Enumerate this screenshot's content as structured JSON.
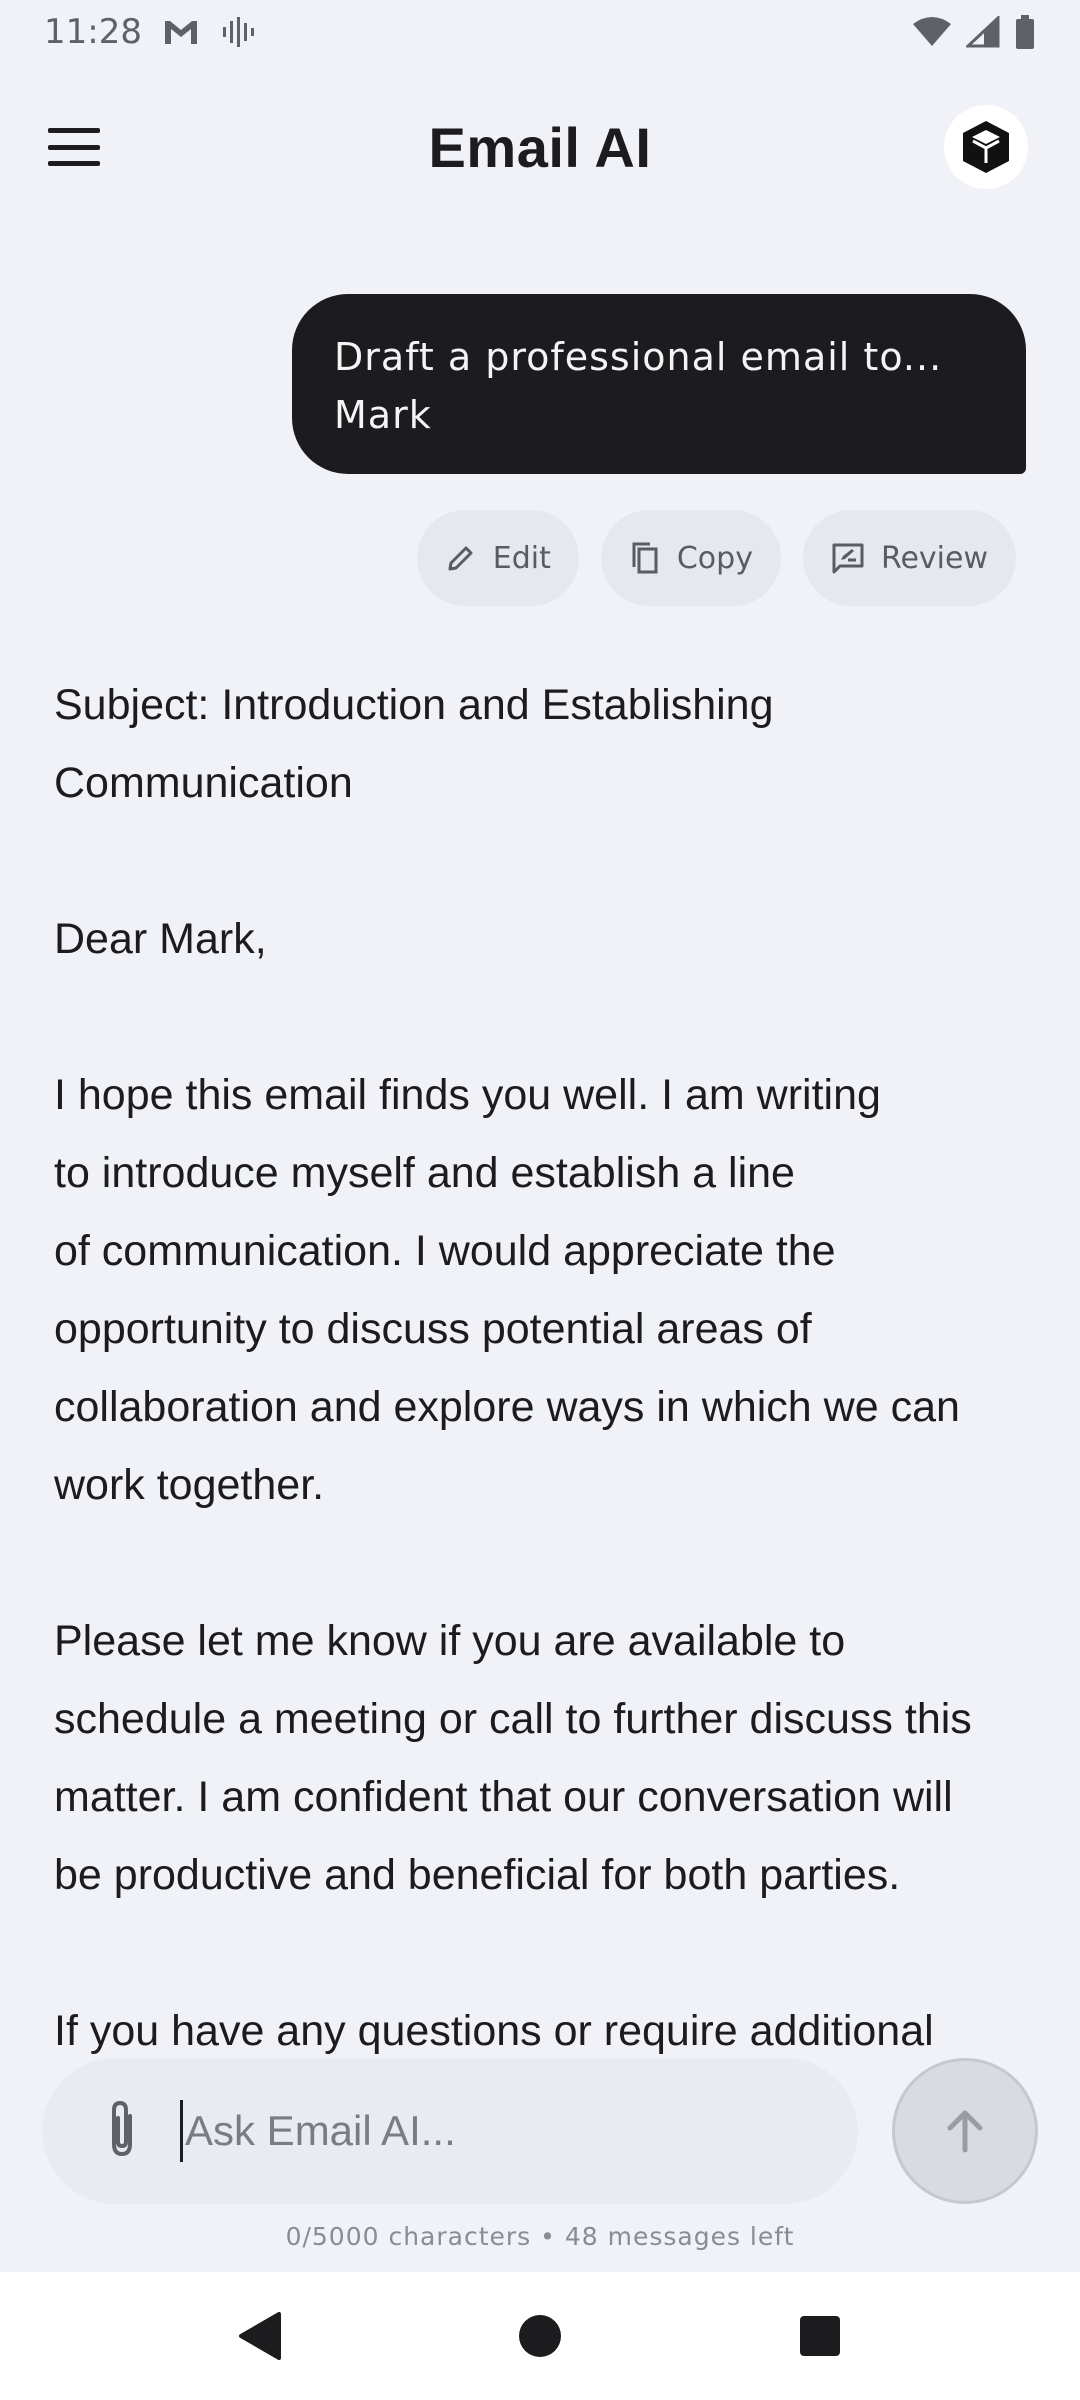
{
  "status_bar": {
    "time": "11:28",
    "icons": [
      "gmail-icon",
      "voice-wave-icon",
      "wifi-icon",
      "cell-signal-icon",
      "battery-icon"
    ]
  },
  "header": {
    "title": "Email AI",
    "menu_icon": "hamburger-menu-icon",
    "logo_icon": "cube-logo-icon"
  },
  "user_message": {
    "lines": [
      "Draft a professional email to...",
      "Mark"
    ]
  },
  "actions": {
    "edit_label": "Edit",
    "copy_label": "Copy",
    "review_label": "Review"
  },
  "email": {
    "subject_lines": [
      "Subject: Introduction and Establishing",
      "Communication"
    ],
    "greeting": "Dear Mark,",
    "paragraph1": [
      "I hope this email finds you well. I am writing",
      "to introduce myself and establish a line",
      "of communication. I would appreciate the",
      "opportunity to discuss potential areas of",
      "collaboration and explore ways in which we can",
      "work together."
    ],
    "paragraph2": [
      "Please let me know if you are available to",
      "schedule a meeting or call to further discuss this",
      "matter. I am confident that our conversation will",
      "be productive and beneficial for both parties."
    ],
    "paragraph3": [
      "If you have any questions or require additional"
    ]
  },
  "composer": {
    "placeholder": "Ask Email AI...",
    "value": "",
    "attach_icon": "paperclip-icon",
    "send_icon": "arrow-up-icon",
    "counter": "0/5000 characters • 48 messages left"
  },
  "colors": {
    "background": "#f0f2f7",
    "bubble": "#1c1c1e",
    "chip": "#e6e8ee",
    "input": "#e8ebf2",
    "send_disabled": "#d9dbe0"
  }
}
